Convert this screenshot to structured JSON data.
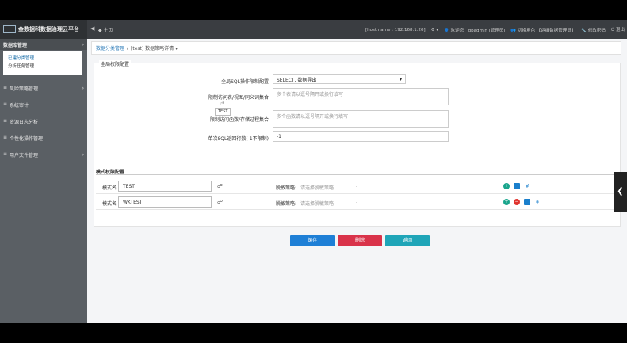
{
  "header": {
    "app_title": "金数据科数据治理云平台",
    "back": "◀",
    "home": "◆ 主页",
    "host": "[host name : 192.168.1.20]",
    "gear": "⚙ ▾",
    "user": "👤 欢迎您，dbadmin [管理员]",
    "role": "👥 切换角色 【运维数据管理员】",
    "change_pwd": "🔧 修改密码",
    "logout": "⏻ 退出"
  },
  "sidebar": {
    "head": "数据库管理",
    "sub_items": [
      "已建分类管理",
      "分析任务管理"
    ],
    "items": [
      {
        "label": "风险策略管理"
      },
      {
        "label": "系统审计"
      },
      {
        "label": "资源日志分析"
      },
      {
        "label": "个性化操作管理"
      },
      {
        "label": "用户文件管理"
      }
    ]
  },
  "breadcrumb": {
    "link": "数据分类管理",
    "sep": "/",
    "current": "[test] 数据策略详情 ▾"
  },
  "form": {
    "legend": "全局权限配置",
    "tooltip": "TEST",
    "fields": [
      {
        "label": "全局SQL操作限制配置",
        "value": "SELECT, 数据导出",
        "type": "select"
      },
      {
        "label": "限制访问表/视图/同义词集合",
        "placeholder": "多个表请以逗号隔开或换行填写",
        "type": "textarea"
      },
      {
        "label": "限制访问函数/存储过程集合",
        "placeholder": "多个函数请以逗号隔开或换行填写",
        "type": "textarea"
      },
      {
        "label": "单次SQL返回行数(-1不限制)",
        "value": "-1",
        "type": "input"
      }
    ]
  },
  "schema": {
    "legend": "模式权限配置",
    "rows": [
      {
        "label": "模式名",
        "value": "TEST",
        "strategy_label": "脱敏策略:",
        "strategy_value": "请选择脱敏策略",
        "dash": "-"
      },
      {
        "label": "模式名",
        "value": "WKTEST",
        "strategy_label": "脱敏策略:",
        "strategy_value": "请选择脱敏策略",
        "dash": "-"
      }
    ]
  },
  "buttons": {
    "save": "保存",
    "delete": "删除",
    "cancel": "返回"
  },
  "colors": {
    "save": "#1e7fd6",
    "delete": "#d9334a",
    "cancel": "#1fa5b8",
    "add_icon": "#1aa58c",
    "copy_icon": "#1a7fcc",
    "del_icon": "#e0342f"
  },
  "icons": {
    "scroll": "❮",
    "tree": "☍"
  }
}
